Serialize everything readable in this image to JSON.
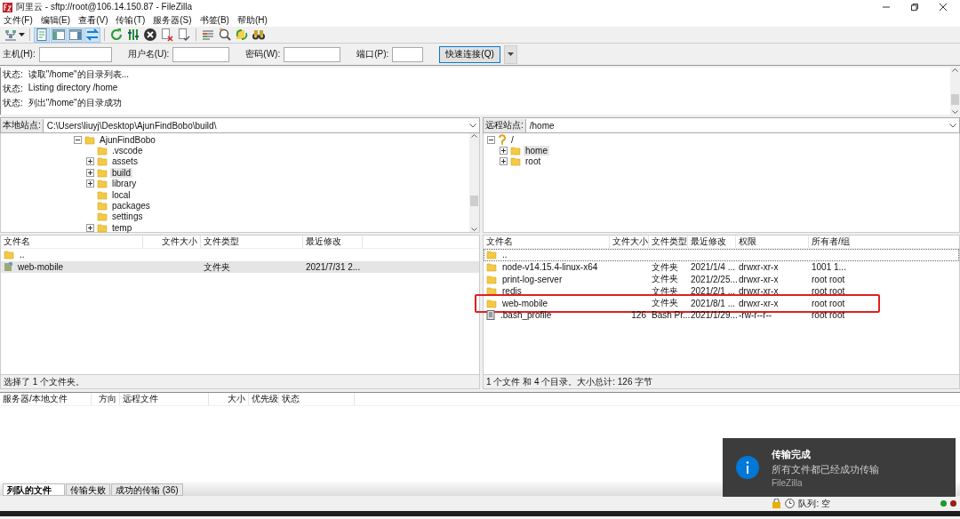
{
  "window": {
    "title": "阿里云 - sftp://root@106.14.150.87 - FileZilla"
  },
  "menu": [
    "文件(F)",
    "编辑(E)",
    "查看(V)",
    "传输(T)",
    "服务器(S)",
    "书签(B)",
    "帮助(H)"
  ],
  "toolbar": [
    {
      "kind": "site-manager",
      "selected": false
    },
    {
      "kind": "message-log",
      "selected": true
    },
    {
      "kind": "local-tree",
      "selected": true
    },
    {
      "kind": "remote-tree",
      "selected": true
    },
    {
      "kind": "transfer-queue",
      "selected": true
    },
    {
      "kind": "refresh",
      "selected": false
    },
    {
      "kind": "process-queue",
      "selected": false
    },
    {
      "kind": "cancel",
      "selected": false
    },
    {
      "kind": "disconnect",
      "selected": false
    },
    {
      "kind": "reconnect",
      "selected": false
    },
    {
      "kind": "filter",
      "selected": false
    },
    {
      "kind": "compare",
      "selected": false
    },
    {
      "kind": "sync-browse",
      "selected": false
    },
    {
      "kind": "search",
      "selected": false
    }
  ],
  "quickconnect": {
    "fields": [
      {
        "label": "主机(H):"
      },
      {
        "label": "用户名(U):"
      },
      {
        "label": "密码(W):"
      },
      {
        "label": "端口(P):"
      }
    ],
    "button": "快速连接(Q)"
  },
  "log": [
    {
      "label": "状态:",
      "text": "读取\"/home\"的目录列表..."
    },
    {
      "label": "状态:",
      "text": "Listing directory /home"
    },
    {
      "label": "状态:",
      "text": "列出\"/home\"的目录成功"
    }
  ],
  "local": {
    "site_label": "本地站点:",
    "path": "C:\\Users\\liuyj\\Desktop\\AjunFindBobo\\build\\",
    "tree": [
      {
        "label": "AjunFindBobo",
        "expandable": true,
        "expanded": true,
        "selected": false,
        "children": [
          {
            "label": ".vscode",
            "expandable": false,
            "selected": false
          },
          {
            "label": "assets",
            "expandable": true,
            "expanded": false,
            "selected": false
          },
          {
            "label": "build",
            "expandable": true,
            "expanded": false,
            "selected": true
          },
          {
            "label": "library",
            "expandable": true,
            "expanded": false,
            "selected": false
          },
          {
            "label": "local",
            "expandable": false,
            "selected": false
          },
          {
            "label": "packages",
            "expandable": false,
            "selected": false
          },
          {
            "label": "settings",
            "expandable": false,
            "selected": false
          },
          {
            "label": "temp",
            "expandable": true,
            "expanded": false,
            "selected": false
          }
        ]
      }
    ],
    "columns": [
      "文件名",
      "文件大小",
      "文件类型",
      "最近修改"
    ],
    "rows": [
      {
        "kind": "parent",
        "selected": false,
        "cells": [
          "..",
          "",
          "",
          ""
        ]
      },
      {
        "kind": "shortcut",
        "selected": true,
        "cells": [
          "web-mobile",
          "",
          "文件夹",
          "2021/7/31 2..."
        ]
      }
    ],
    "status": "选择了 1 个文件夹。"
  },
  "remote": {
    "site_label": "远程站点:",
    "path": "/home",
    "tree": [
      {
        "label": "/",
        "expandable": true,
        "expanded": true,
        "kind": "unknown",
        "selected": false,
        "children": [
          {
            "label": "home",
            "expandable": true,
            "expanded": false,
            "selected": true
          },
          {
            "label": "root",
            "expandable": true,
            "expanded": false,
            "selected": false
          }
        ]
      }
    ],
    "columns": [
      "文件名",
      "文件大小",
      "文件类型",
      "最近修改",
      "权限",
      "所有者/组"
    ],
    "rows": [
      {
        "kind": "folder",
        "focused": true,
        "highlighted": false,
        "cells": [
          "..",
          "",
          "",
          "",
          "",
          ""
        ]
      },
      {
        "kind": "folder",
        "focused": false,
        "highlighted": false,
        "cells": [
          "node-v14.15.4-linux-x64",
          "",
          "文件夹",
          "2021/1/4 ...",
          "drwxr-xr-x",
          "1001 1..."
        ]
      },
      {
        "kind": "folder",
        "focused": false,
        "highlighted": false,
        "cells": [
          "print-log-server",
          "",
          "文件夹",
          "2021/2/25...",
          "drwxr-xr-x",
          "root root"
        ]
      },
      {
        "kind": "folder",
        "focused": false,
        "highlighted": false,
        "cells": [
          "redis",
          "",
          "文件夹",
          "2021/2/1 ...",
          "drwxr-xr-x",
          "root root"
        ]
      },
      {
        "kind": "folder",
        "focused": false,
        "highlighted": true,
        "cells": [
          "web-mobile",
          "",
          "文件夹",
          "2021/8/1 ...",
          "drwxr-xr-x",
          "root root"
        ]
      },
      {
        "kind": "file",
        "focused": false,
        "highlighted": false,
        "cells": [
          ".bash_profile",
          "126",
          "Bash Pr...",
          "2021/1/29...",
          "-rw-r--r--",
          "root root"
        ]
      }
    ],
    "status": "1 个文件 和 4 个目录。大小总计: 126 字节"
  },
  "queue": {
    "columns": [
      "服务器/本地文件",
      "方向",
      "远程文件",
      "大小",
      "优先级",
      "状态"
    ]
  },
  "queue_tabs": [
    {
      "label": "列队的文件",
      "selected": true
    },
    {
      "label": "传输失败",
      "selected": false
    },
    {
      "label": "成功的传输 (36)",
      "selected": false
    }
  ],
  "status_bar": {
    "queue": "队列: 空"
  },
  "toast": {
    "title": "传输完成",
    "message": "所有文件都已经成功传输",
    "app": "FileZilla"
  }
}
